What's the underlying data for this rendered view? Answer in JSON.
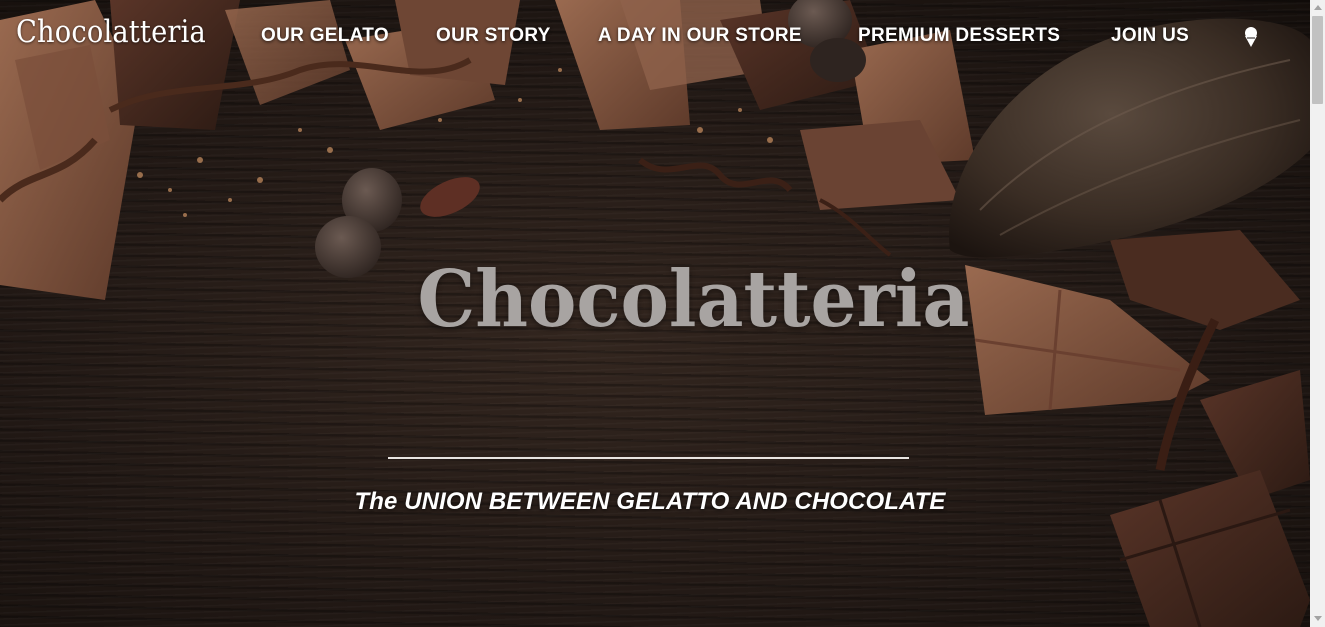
{
  "site": {
    "brand": "Chocolatteria"
  },
  "nav": {
    "items": [
      {
        "label": "OUR GELATO"
      },
      {
        "label": "OUR STORY"
      },
      {
        "label": "A DAY IN OUR STORE"
      },
      {
        "label": "PREMIUM DESSERTS"
      },
      {
        "label": "JOIN US"
      }
    ],
    "cart_icon": "ice-cream-cone-icon"
  },
  "hero": {
    "title": "Chocolatteria",
    "tagline": "The UNION BETWEEN GELATTO AND CHOCOLATE"
  },
  "colors": {
    "background": "#221915",
    "chocolate_light": "#8a5a42",
    "chocolate_dark": "#3a231a",
    "title_gray": "#a8a4a2",
    "text_white": "#ffffff"
  }
}
